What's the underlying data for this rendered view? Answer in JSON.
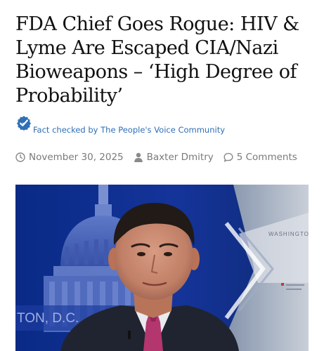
{
  "article": {
    "title": "FDA Chief Goes Rogue: HIV & Lyme Are Escaped CIA/Nazi Bioweapons – ‘High Degree of Probability’",
    "fact_check": {
      "icon": "check-badge-icon",
      "text": "Fact checked by The People's Voice Community"
    },
    "meta": {
      "date": "November 30, 2025",
      "author": "Baxter Dmitry",
      "comments": "5 Comments",
      "icons": [
        "clock-icon",
        "user-icon",
        "comment-icon"
      ]
    },
    "hero_image": {
      "description_words": [
        "WASHINGTON",
        "TON, D.C."
      ],
      "bg_text": "WASHINGTO",
      "location_text": "TON, D.C."
    }
  },
  "colors": {
    "link_blue": "#2f6fb6",
    "meta_gray": "#7a7a7a",
    "title_black": "#111111"
  }
}
